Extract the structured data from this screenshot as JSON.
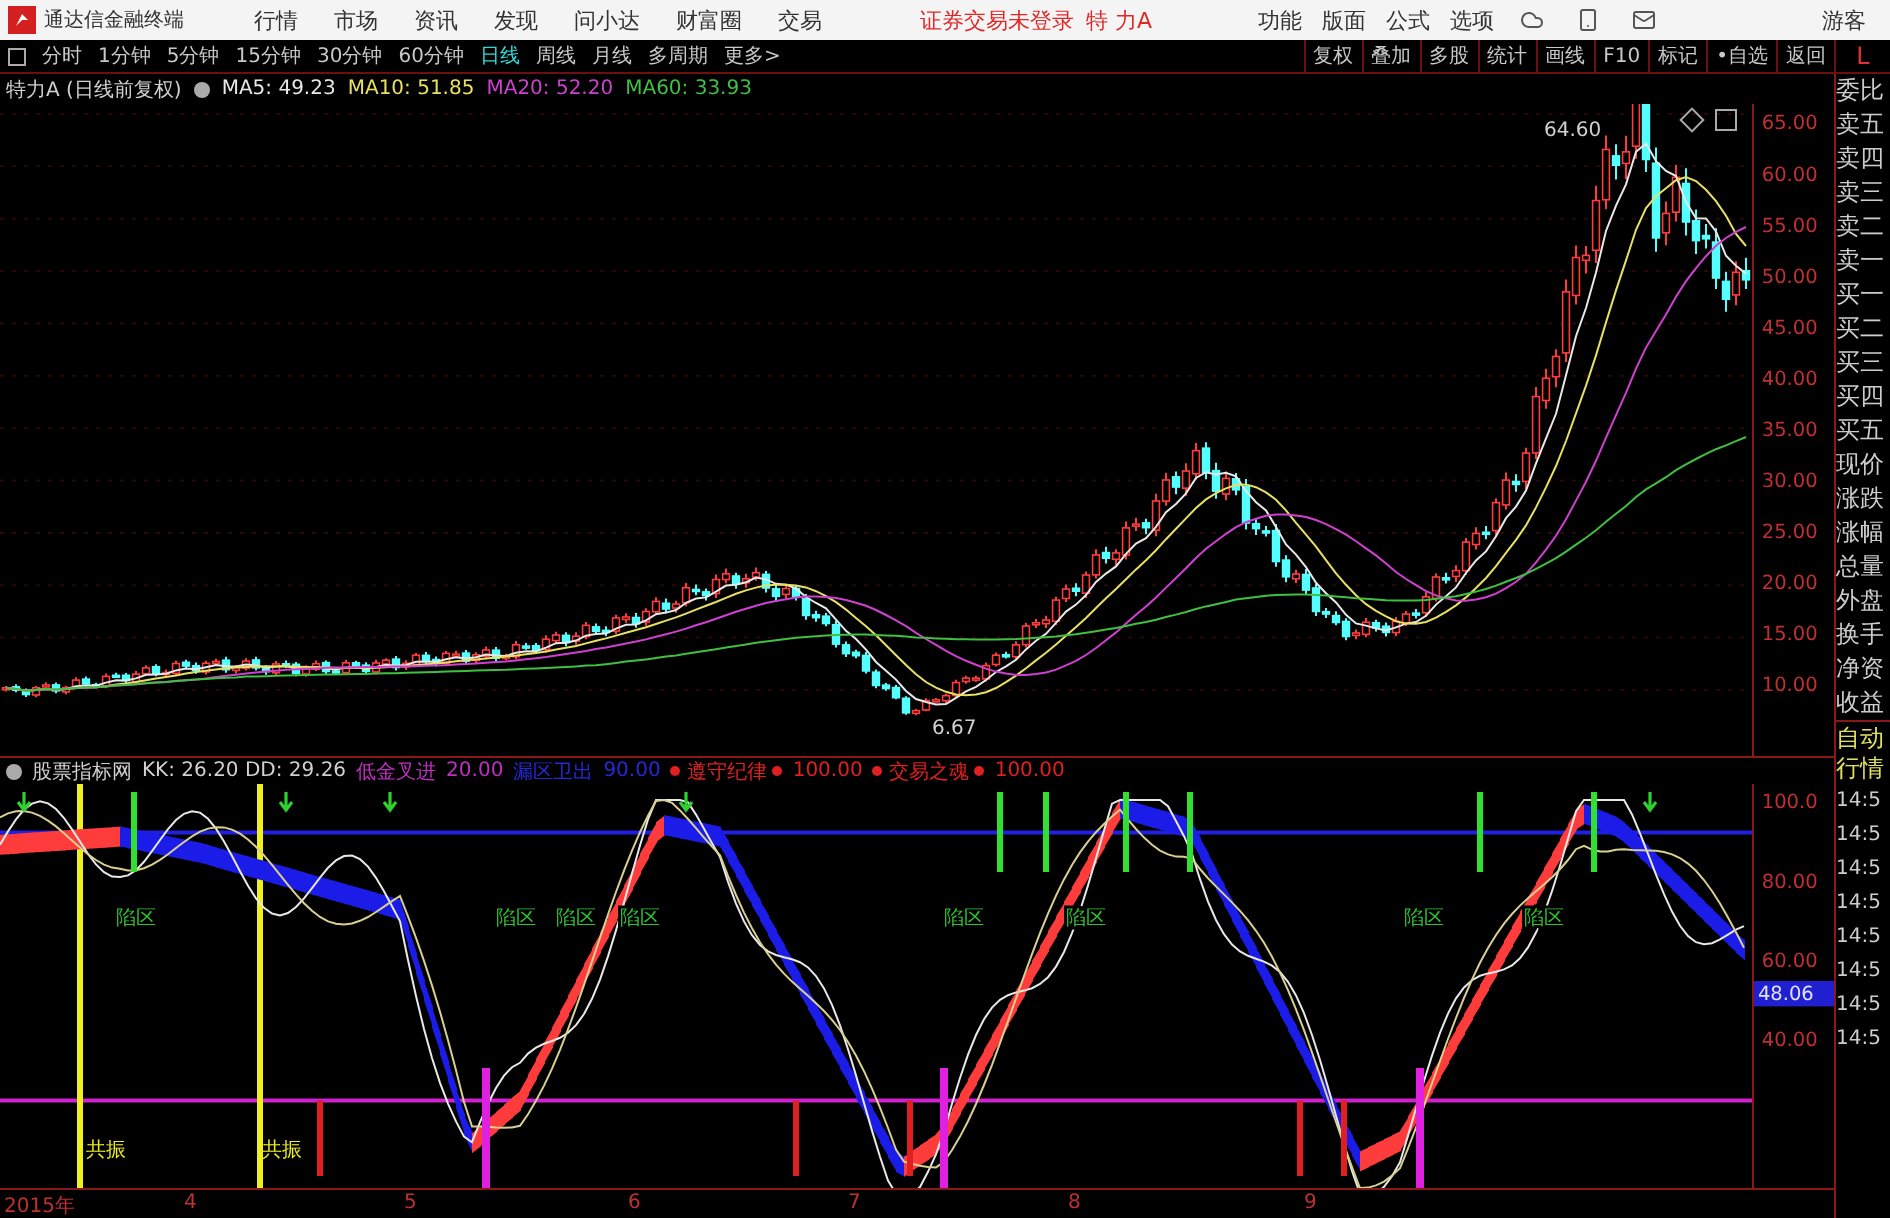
{
  "app_bar": {
    "title": "通达信金融终端",
    "menus": [
      "行情",
      "市场",
      "资讯",
      "发现",
      "问小达",
      "财富圈",
      "交易"
    ],
    "login_status": "证券交易未登录",
    "stock_name": "特 力A",
    "tools": [
      "功能",
      "版面",
      "公式",
      "选项"
    ],
    "user": "游客"
  },
  "toolbar": {
    "periods": [
      {
        "label": "分时",
        "selected": false
      },
      {
        "label": "1分钟",
        "selected": false
      },
      {
        "label": "5分钟",
        "selected": false
      },
      {
        "label": "15分钟",
        "selected": false
      },
      {
        "label": "30分钟",
        "selected": false
      },
      {
        "label": "60分钟",
        "selected": false
      },
      {
        "label": "日线",
        "selected": true
      },
      {
        "label": "周线",
        "selected": false
      },
      {
        "label": "月线",
        "selected": false
      },
      {
        "label": "多周期",
        "selected": false
      }
    ],
    "more": "更多>",
    "buttons": [
      "复权",
      "叠加",
      "多股",
      "统计",
      "画线",
      "F10",
      "标记",
      "•自选",
      "返回"
    ]
  },
  "price_panel": {
    "title": "特力A (日线前复权)",
    "averages": [
      {
        "label": "MA5: 49.23",
        "color": "#e8e8e8"
      },
      {
        "label": "MA10: 51.85",
        "color": "#e8e060"
      },
      {
        "label": "MA20: 52.20",
        "color": "#d040d0"
      },
      {
        "label": "MA60: 33.93",
        "color": "#40c040"
      }
    ],
    "high_label": "64.60",
    "low_label": "6.67",
    "axis": [
      "65.00",
      "60.00",
      "55.00",
      "50.00",
      "45.00",
      "40.00",
      "35.00",
      "30.00",
      "25.00",
      "20.00",
      "15.00",
      "10.00"
    ]
  },
  "indicator_panel": {
    "title": "股票指标网",
    "readings": "KK: 26.20  DD: 29.26",
    "signals": [
      {
        "name": "低金叉进",
        "value": "20.00",
        "color": "#c030c0",
        "dotted": false
      },
      {
        "name": "漏区卫出",
        "value": "90.00",
        "color": "#2828d8",
        "dotted": false
      },
      {
        "name": "遵守纪律",
        "value": "100.00",
        "color": "#e02020",
        "dotted": true
      },
      {
        "name": "交易之魂",
        "value": "100.00",
        "color": "#e02020",
        "dotted": true
      }
    ],
    "zone_labels": [
      "陷区",
      "陷区",
      "陷区",
      "陷区",
      "陷区",
      "陷区",
      "陷区",
      "陷区"
    ],
    "resonance_labels": [
      "共振",
      "共振"
    ],
    "axis": [
      "100.0",
      "80.00",
      "60.00",
      "40.00"
    ],
    "current_value": "48.06"
  },
  "date_axis": [
    "2015年",
    "4",
    "5",
    "6",
    "7",
    "8",
    "9"
  ],
  "quote_panel": {
    "corner": "L",
    "fields": [
      "委比",
      "卖五",
      "卖四",
      "卖三",
      "卖二",
      "卖一",
      "买一",
      "买二",
      "买三",
      "买四",
      "买五",
      "现价",
      "涨跌",
      "涨幅",
      "总量",
      "外盘",
      "换手",
      "净资",
      "收益"
    ],
    "auto": "自动",
    "market": "行情",
    "times": [
      "14:5",
      "14:5",
      "14:5",
      "14:5",
      "14:5",
      "14:5",
      "14:5",
      "14:5"
    ]
  }
}
